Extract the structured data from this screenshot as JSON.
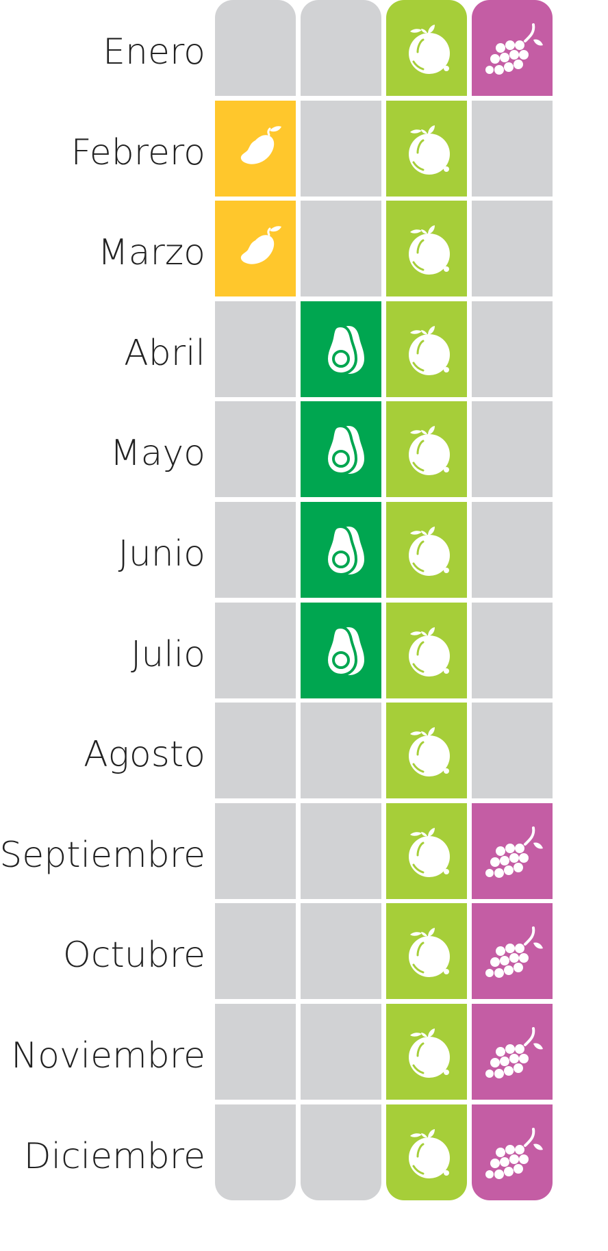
{
  "months": [
    {
      "label": "Enero",
      "mango": false,
      "avocado": false,
      "lime": true,
      "grapes": true
    },
    {
      "label": "Febrero",
      "mango": true,
      "avocado": false,
      "lime": true,
      "grapes": false
    },
    {
      "label": "Marzo",
      "mango": true,
      "avocado": false,
      "lime": true,
      "grapes": false
    },
    {
      "label": "Abril",
      "mango": false,
      "avocado": true,
      "lime": true,
      "grapes": false
    },
    {
      "label": "Mayo",
      "mango": false,
      "avocado": true,
      "lime": true,
      "grapes": false
    },
    {
      "label": "Junio",
      "mango": false,
      "avocado": true,
      "lime": true,
      "grapes": false
    },
    {
      "label": "Julio",
      "mango": false,
      "avocado": true,
      "lime": true,
      "grapes": false
    },
    {
      "label": "Agosto",
      "mango": false,
      "avocado": false,
      "lime": true,
      "grapes": false
    },
    {
      "label": "Septiembre",
      "mango": false,
      "avocado": false,
      "lime": true,
      "grapes": true
    },
    {
      "label": "Octubre",
      "mango": false,
      "avocado": false,
      "lime": true,
      "grapes": true
    },
    {
      "label": "Noviembre",
      "mango": false,
      "avocado": false,
      "lime": true,
      "grapes": true
    },
    {
      "label": "Diciembre",
      "mango": false,
      "avocado": false,
      "lime": true,
      "grapes": true
    }
  ],
  "columns": [
    {
      "key": "mango",
      "icon": "mango-icon",
      "color": "#FFC72C"
    },
    {
      "key": "avocado",
      "icon": "avocado-icon",
      "color": "#00A650"
    },
    {
      "key": "lime",
      "icon": "lime-icon",
      "color": "#A6CE39"
    },
    {
      "key": "grapes",
      "icon": "grapes-icon",
      "color": "#C45DA4"
    }
  ],
  "empty_color": "#D1D2D4"
}
